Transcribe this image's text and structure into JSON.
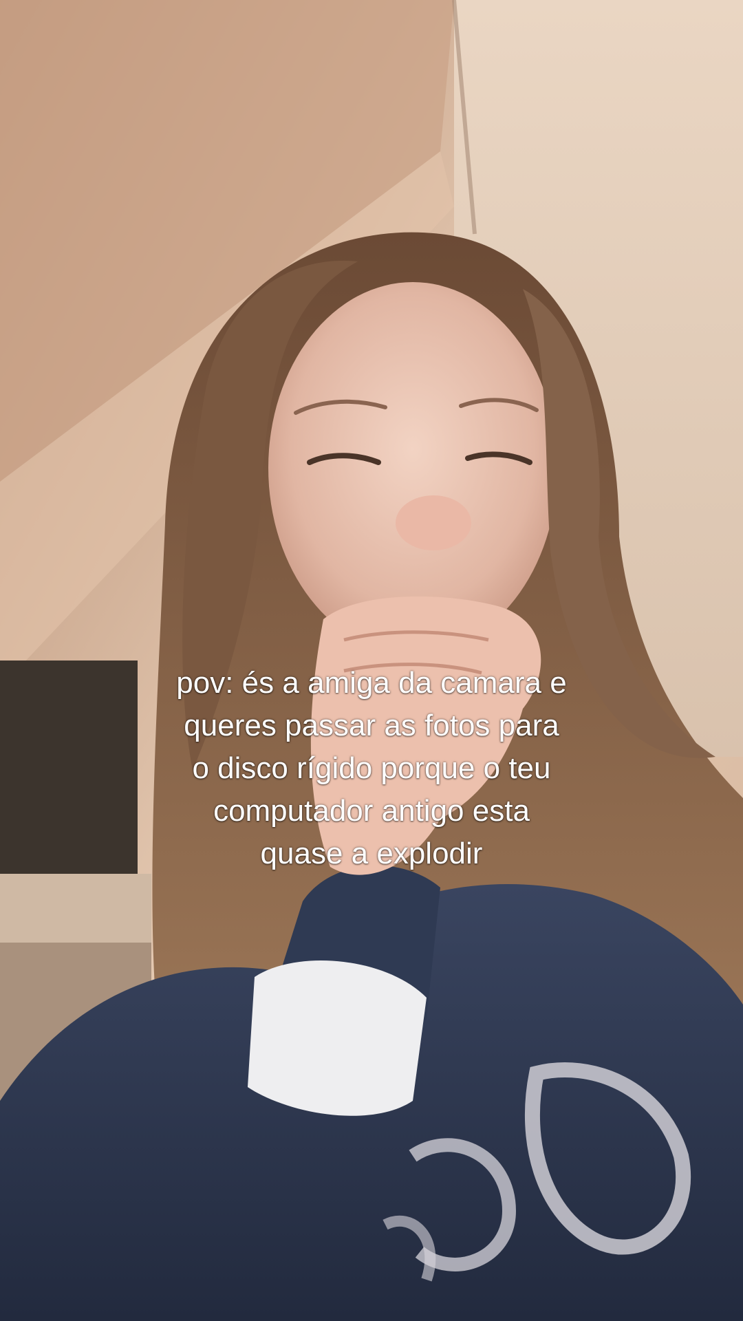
{
  "caption": {
    "lines": [
      "pov: és a amiga da camara e",
      "queres passar as fotos para",
      "o disco rígido porque o teu",
      "computador antigo esta",
      "quase a explodir"
    ]
  }
}
